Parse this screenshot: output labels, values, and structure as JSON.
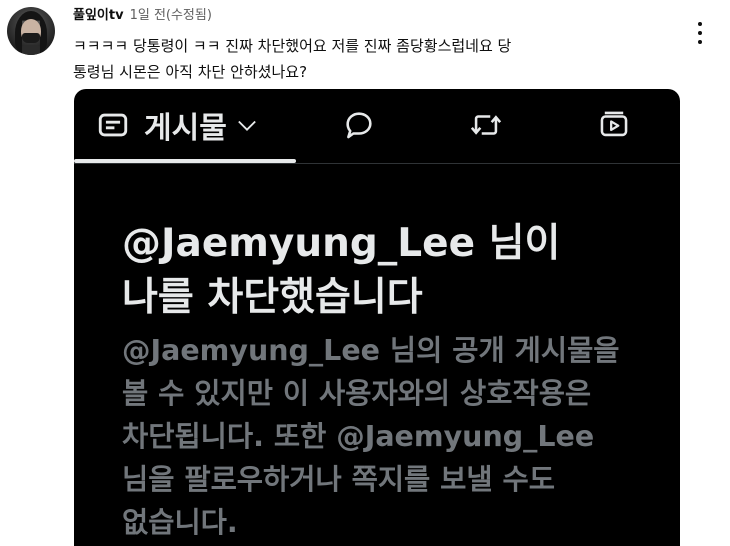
{
  "comment": {
    "author": "풀잎이tv",
    "time": "1일 전(수정됨)",
    "text": "ㅋㅋㅋㅋ  당통령이 ㅋㅋ 진짜 차단했어요  저를  진짜 좀당황스럽네요 당\n통령님 시몬은 아직 차단 안하셨나요?"
  },
  "screenshot": {
    "tabs": {
      "posts": "게시물"
    },
    "title": "@Jaemyung_Lee 님이\n나를 차단했습니다",
    "description": "@Jaemyung_Lee 님의 공개 게시물을\n볼 수 있지만 이 사용자와의 상호작용은\n차단됩니다. 또한 @Jaemyung_Lee\n님을 팔로우하거나 쪽지를 보낼 수도\n없습니다."
  },
  "icons": {
    "more": "more-vert-icon",
    "posts": "document-icon",
    "dropdown": "chevron-down-icon",
    "replies": "speech-bubble-icon",
    "reposts": "repost-icon",
    "media": "video-icon"
  },
  "colors": {
    "background": "#ffffff",
    "screenshot_bg": "#000000",
    "primary_text": "#e7e9ea",
    "secondary_text": "#71767b"
  }
}
